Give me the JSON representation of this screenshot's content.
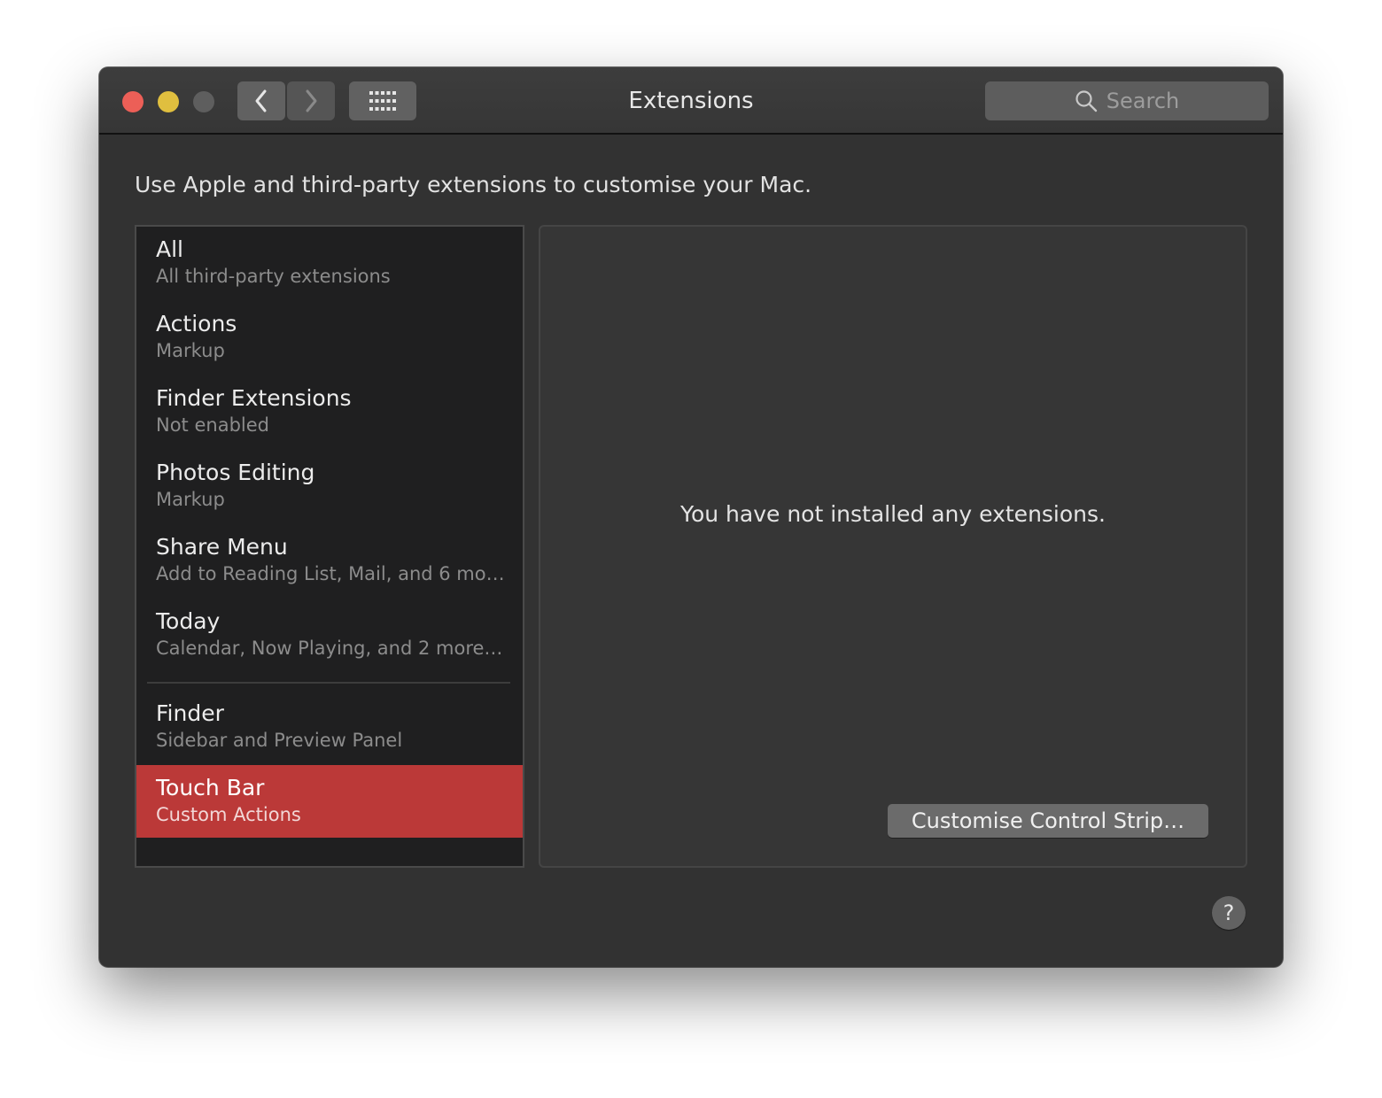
{
  "window": {
    "title": "Extensions",
    "search_placeholder": "Search"
  },
  "toolbar": {
    "back_icon": "chevron-left-icon",
    "forward_icon": "chevron-right-icon",
    "grid_icon": "grid-icon",
    "search_icon": "magnifier-icon"
  },
  "intro_text": "Use Apple and third-party extensions to customise your Mac.",
  "sidebar": {
    "items": [
      {
        "name": "All",
        "sub": "All third-party extensions"
      },
      {
        "name": "Actions",
        "sub": "Markup"
      },
      {
        "name": "Finder Extensions",
        "sub": "Not enabled"
      },
      {
        "name": "Photos Editing",
        "sub": "Markup"
      },
      {
        "name": "Share Menu",
        "sub": "Add to Reading List, Mail, and 6 mor…"
      },
      {
        "name": "Today",
        "sub": "Calendar, Now Playing, and 2 more…"
      },
      {
        "name": "Finder",
        "sub": "Sidebar and Preview Panel"
      },
      {
        "name": "Touch Bar",
        "sub": "Custom Actions"
      }
    ],
    "selected": "Touch Bar"
  },
  "detail": {
    "empty_message": "You have not installed any extensions.",
    "button_label": "Customise Control Strip…"
  },
  "help_label": "?",
  "colors": {
    "selection": "#bb3938",
    "close": "#ec5f57",
    "minimize": "#e0bf3f"
  }
}
